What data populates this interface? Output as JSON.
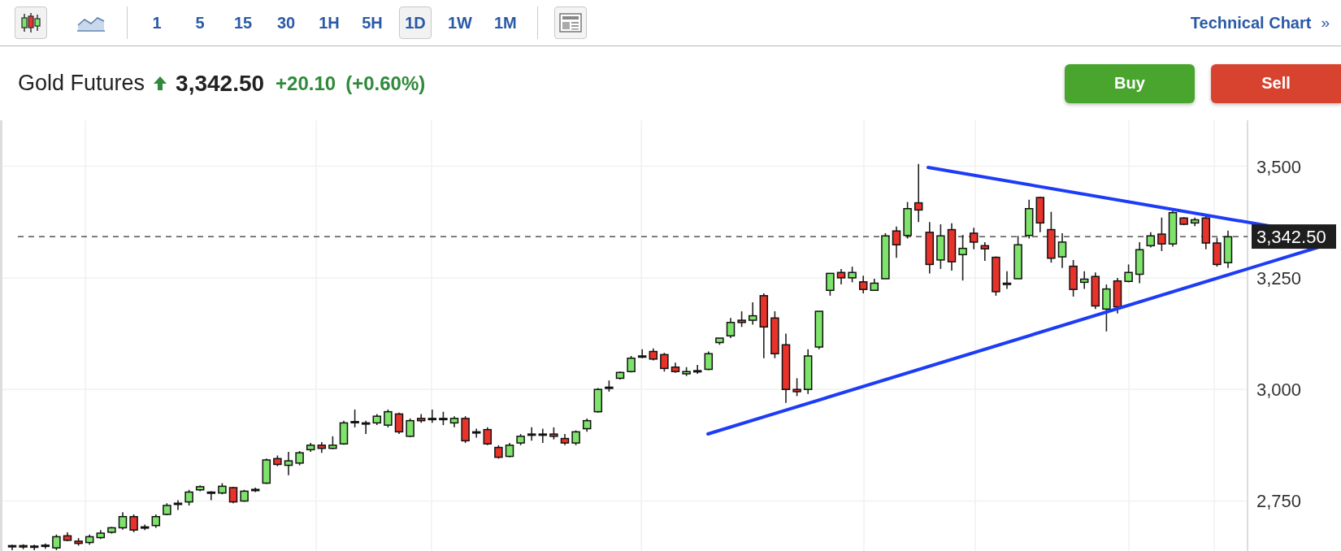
{
  "toolbar": {
    "chart_types": [
      {
        "kind": "candlestick",
        "selected": true
      },
      {
        "kind": "area",
        "selected": false
      }
    ],
    "intervals": [
      {
        "label": "1",
        "selected": false
      },
      {
        "label": "5",
        "selected": false
      },
      {
        "label": "15",
        "selected": false
      },
      {
        "label": "30",
        "selected": false
      },
      {
        "label": "1H",
        "selected": false
      },
      {
        "label": "5H",
        "selected": false
      },
      {
        "label": "1D",
        "selected": true
      },
      {
        "label": "1W",
        "selected": false
      },
      {
        "label": "1M",
        "selected": false
      }
    ],
    "link": {
      "label": "Technical Chart",
      "chevron": "»"
    }
  },
  "quote": {
    "name": "Gold Futures",
    "price": "3,342.50",
    "change": "+20.10",
    "change_percent": "(+0.60%)"
  },
  "buttons": [
    {
      "kind": "buy",
      "label": "Buy"
    },
    {
      "kind": "sell",
      "label": "Sell"
    }
  ],
  "chart_data": {
    "type": "candlestick",
    "ylim": [
      2638,
      3603
    ],
    "grid": true,
    "yticks": [
      {
        "value": 2750,
        "label": "2,750"
      },
      {
        "value": 3000,
        "label": "3,000"
      },
      {
        "value": 3250,
        "label": "3,250"
      },
      {
        "value": 3500,
        "label": "3,500"
      }
    ],
    "ref_lines": [
      {
        "axis": "y",
        "value": 3342.5,
        "label": "3,342.50"
      }
    ],
    "ohlc": [
      [
        2648,
        2652,
        2640,
        2650
      ],
      [
        2650,
        2653,
        2642,
        2647
      ],
      [
        2647,
        2652,
        2640,
        2649
      ],
      [
        2649,
        2655,
        2643,
        2651
      ],
      [
        2645,
        2675,
        2640,
        2670
      ],
      [
        2672,
        2680,
        2660,
        2662
      ],
      [
        2660,
        2667,
        2650,
        2655
      ],
      [
        2657,
        2675,
        2652,
        2670
      ],
      [
        2668,
        2685,
        2665,
        2678
      ],
      [
        2680,
        2692,
        2677,
        2690
      ],
      [
        2690,
        2725,
        2686,
        2715
      ],
      [
        2715,
        2720,
        2680,
        2685
      ],
      [
        2690,
        2697,
        2685,
        2692
      ],
      [
        2695,
        2720,
        2690,
        2715
      ],
      [
        2720,
        2745,
        2718,
        2740
      ],
      [
        2745,
        2752,
        2730,
        2745
      ],
      [
        2748,
        2775,
        2740,
        2770
      ],
      [
        2775,
        2785,
        2772,
        2782
      ],
      [
        2770,
        2772,
        2752,
        2770
      ],
      [
        2768,
        2790,
        2765,
        2783
      ],
      [
        2780,
        2782,
        2745,
        2748
      ],
      [
        2750,
        2775,
        2748,
        2772
      ],
      [
        2775,
        2780,
        2770,
        2776
      ],
      [
        2790,
        2845,
        2788,
        2842
      ],
      [
        2845,
        2852,
        2828,
        2832
      ],
      [
        2830,
        2860,
        2808,
        2840
      ],
      [
        2835,
        2862,
        2830,
        2858
      ],
      [
        2865,
        2880,
        2860,
        2875
      ],
      [
        2875,
        2882,
        2858,
        2868
      ],
      [
        2868,
        2895,
        2866,
        2875
      ],
      [
        2878,
        2930,
        2876,
        2925
      ],
      [
        2928,
        2955,
        2915,
        2928
      ],
      [
        2925,
        2930,
        2900,
        2925
      ],
      [
        2925,
        2945,
        2920,
        2940
      ],
      [
        2920,
        2955,
        2915,
        2950
      ],
      [
        2945,
        2948,
        2900,
        2905
      ],
      [
        2895,
        2935,
        2893,
        2930
      ],
      [
        2935,
        2945,
        2925,
        2930
      ],
      [
        2935,
        2955,
        2925,
        2935
      ],
      [
        2935,
        2950,
        2920,
        2933
      ],
      [
        2925,
        2940,
        2915,
        2935
      ],
      [
        2935,
        2940,
        2880,
        2885
      ],
      [
        2905,
        2912,
        2892,
        2905
      ],
      [
        2910,
        2915,
        2875,
        2878
      ],
      [
        2870,
        2875,
        2845,
        2848
      ],
      [
        2850,
        2880,
        2848,
        2875
      ],
      [
        2880,
        2900,
        2875,
        2895
      ],
      [
        2900,
        2915,
        2885,
        2900
      ],
      [
        2900,
        2912,
        2880,
        2900
      ],
      [
        2900,
        2915,
        2888,
        2895
      ],
      [
        2890,
        2900,
        2875,
        2880
      ],
      [
        2880,
        2908,
        2875,
        2905
      ],
      [
        2912,
        2935,
        2905,
        2930
      ],
      [
        2950,
        3003,
        2948,
        3000
      ],
      [
        3005,
        3020,
        2995,
        3005
      ],
      [
        3025,
        3040,
        3022,
        3038
      ],
      [
        3040,
        3075,
        3038,
        3070
      ],
      [
        3075,
        3090,
        3070,
        3075
      ],
      [
        3085,
        3092,
        3065,
        3068
      ],
      [
        3078,
        3082,
        3040,
        3047
      ],
      [
        3050,
        3060,
        3037,
        3040
      ],
      [
        3035,
        3050,
        3030,
        3040
      ],
      [
        3040,
        3055,
        3035,
        3042
      ],
      [
        3045,
        3085,
        3043,
        3080
      ],
      [
        3105,
        3115,
        3100,
        3115
      ],
      [
        3120,
        3160,
        3115,
        3150
      ],
      [
        3155,
        3175,
        3140,
        3150
      ],
      [
        3155,
        3195,
        3145,
        3165
      ],
      [
        3210,
        3215,
        3070,
        3140
      ],
      [
        3160,
        3175,
        3070,
        3080
      ],
      [
        3100,
        3125,
        2970,
        3000
      ],
      [
        3000,
        3025,
        2985,
        2995
      ],
      [
        3000,
        3090,
        2990,
        3075
      ],
      [
        3095,
        3175,
        3090,
        3175
      ],
      [
        3222,
        3260,
        3210,
        3260
      ],
      [
        3262,
        3270,
        3235,
        3250
      ],
      [
        3250,
        3275,
        3240,
        3262
      ],
      [
        3241,
        3255,
        3215,
        3224
      ],
      [
        3222,
        3248,
        3222,
        3238
      ],
      [
        3248,
        3350,
        3248,
        3344
      ],
      [
        3355,
        3365,
        3295,
        3324
      ],
      [
        3345,
        3420,
        3338,
        3405
      ],
      [
        3418,
        3505,
        3375,
        3402
      ],
      [
        3352,
        3375,
        3260,
        3280
      ],
      [
        3290,
        3370,
        3270,
        3344
      ],
      [
        3358,
        3372,
        3266,
        3286
      ],
      [
        3302,
        3346,
        3244,
        3316
      ],
      [
        3350,
        3362,
        3314,
        3330
      ],
      [
        3322,
        3330,
        3288,
        3315
      ],
      [
        3296,
        3298,
        3210,
        3219
      ],
      [
        3235,
        3265,
        3225,
        3238
      ],
      [
        3248,
        3344,
        3248,
        3324
      ],
      [
        3345,
        3425,
        3338,
        3405
      ],
      [
        3430,
        3432,
        3352,
        3373
      ],
      [
        3358,
        3398,
        3284,
        3294
      ],
      [
        3297,
        3350,
        3272,
        3330
      ],
      [
        3276,
        3290,
        3208,
        3224
      ],
      [
        3240,
        3265,
        3225,
        3247
      ],
      [
        3253,
        3262,
        3180,
        3187
      ],
      [
        3180,
        3235,
        3130,
        3225
      ],
      [
        3243,
        3250,
        3170,
        3185
      ],
      [
        3242,
        3280,
        3240,
        3262
      ],
      [
        3258,
        3330,
        3238,
        3313
      ],
      [
        3322,
        3352,
        3318,
        3344
      ],
      [
        3348,
        3385,
        3310,
        3326
      ],
      [
        3326,
        3400,
        3320,
        3396
      ],
      [
        3384,
        3386,
        3368,
        3370
      ],
      [
        3373,
        3385,
        3366,
        3380
      ],
      [
        3384,
        3388,
        3314,
        3328
      ],
      [
        3328,
        3340,
        3275,
        3280
      ],
      [
        3284,
        3356,
        3272,
        3342
      ]
    ]
  }
}
